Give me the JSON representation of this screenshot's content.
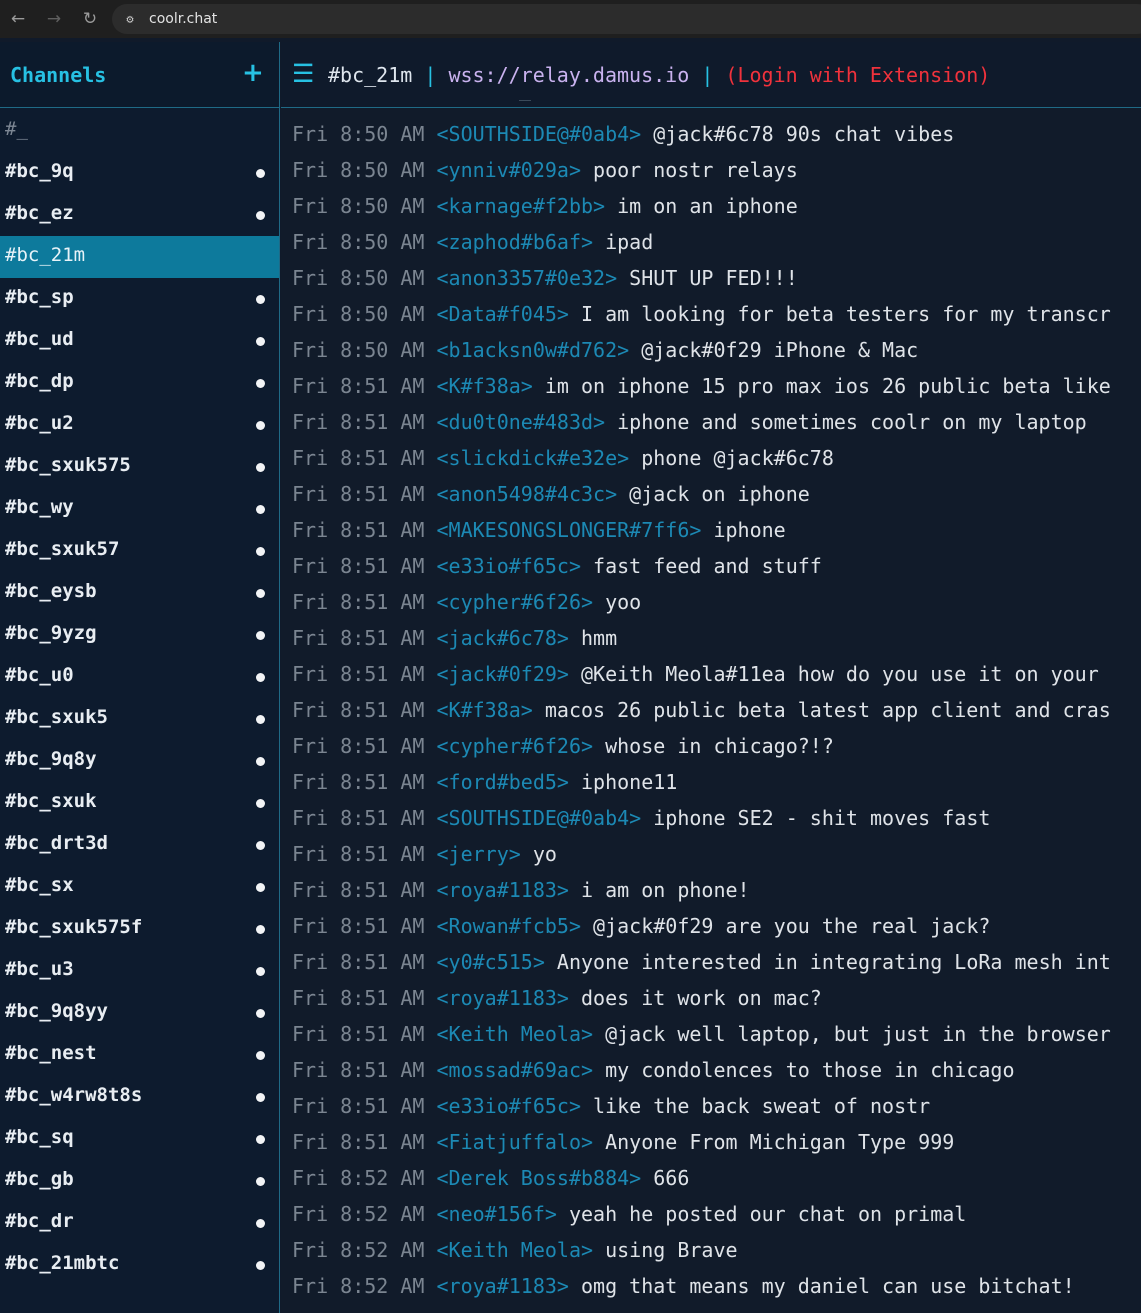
{
  "browser": {
    "url": "coolr.chat",
    "back_icon": "←",
    "forward_icon": "→",
    "reload_icon": "↻",
    "site_info_icon": "⚙"
  },
  "sidebar": {
    "title": "Channels",
    "add_icon": "+",
    "channels": [
      {
        "label": "#_",
        "dim": true,
        "active": false,
        "unread": false
      },
      {
        "label": "#bc_9q",
        "dim": false,
        "active": false,
        "unread": true
      },
      {
        "label": "#bc_ez",
        "dim": false,
        "active": false,
        "unread": true
      },
      {
        "label": "#bc_21m",
        "dim": false,
        "active": true,
        "unread": false
      },
      {
        "label": "#bc_sp",
        "dim": false,
        "active": false,
        "unread": true
      },
      {
        "label": "#bc_ud",
        "dim": false,
        "active": false,
        "unread": true
      },
      {
        "label": "#bc_dp",
        "dim": false,
        "active": false,
        "unread": true
      },
      {
        "label": "#bc_u2",
        "dim": false,
        "active": false,
        "unread": true
      },
      {
        "label": "#bc_sxuk575",
        "dim": false,
        "active": false,
        "unread": true
      },
      {
        "label": "#bc_wy",
        "dim": false,
        "active": false,
        "unread": true
      },
      {
        "label": "#bc_sxuk57",
        "dim": false,
        "active": false,
        "unread": true
      },
      {
        "label": "#bc_eysb",
        "dim": false,
        "active": false,
        "unread": true
      },
      {
        "label": "#bc_9yzg",
        "dim": false,
        "active": false,
        "unread": true
      },
      {
        "label": "#bc_u0",
        "dim": false,
        "active": false,
        "unread": true
      },
      {
        "label": "#bc_sxuk5",
        "dim": false,
        "active": false,
        "unread": true
      },
      {
        "label": "#bc_9q8y",
        "dim": false,
        "active": false,
        "unread": true
      },
      {
        "label": "#bc_sxuk",
        "dim": false,
        "active": false,
        "unread": true
      },
      {
        "label": "#bc_drt3d",
        "dim": false,
        "active": false,
        "unread": true
      },
      {
        "label": "#bc_sx",
        "dim": false,
        "active": false,
        "unread": true
      },
      {
        "label": "#bc_sxuk575f",
        "dim": false,
        "active": false,
        "unread": true
      },
      {
        "label": "#bc_u3",
        "dim": false,
        "active": false,
        "unread": true
      },
      {
        "label": "#bc_9q8yy",
        "dim": false,
        "active": false,
        "unread": true
      },
      {
        "label": "#bc_nest",
        "dim": false,
        "active": false,
        "unread": true
      },
      {
        "label": "#bc_w4rw8t8s",
        "dim": false,
        "active": false,
        "unread": true
      },
      {
        "label": "#bc_sq",
        "dim": false,
        "active": false,
        "unread": true
      },
      {
        "label": "#bc_gb",
        "dim": false,
        "active": false,
        "unread": true
      },
      {
        "label": "#bc_dr",
        "dim": false,
        "active": false,
        "unread": true
      },
      {
        "label": "#bc_21mbtc",
        "dim": false,
        "active": false,
        "unread": true
      }
    ]
  },
  "header": {
    "menu_icon": "☰",
    "channel": "#bc_21m",
    "separator": "|",
    "relay": "wss://relay.damus.io",
    "login": "(Login with Extension)"
  },
  "messages": [
    {
      "time": "Fri 8:50 AM",
      "nick": "<SOUTHSIDE@#0ab4>",
      "text": "@jack#6c78 90s chat vibes"
    },
    {
      "time": "Fri 8:50 AM",
      "nick": "<ynniv#029a>",
      "text": "poor nostr relays"
    },
    {
      "time": "Fri 8:50 AM",
      "nick": "<karnage#f2bb>",
      "text": "im on an iphone"
    },
    {
      "time": "Fri 8:50 AM",
      "nick": "<zaphod#b6af>",
      "text": "ipad"
    },
    {
      "time": "Fri 8:50 AM",
      "nick": "<anon3357#0e32>",
      "text": "SHUT UP FED!!!"
    },
    {
      "time": "Fri 8:50 AM",
      "nick": "<Data#f045>",
      "text": "I am looking for beta testers for my transcr"
    },
    {
      "time": "Fri 8:50 AM",
      "nick": "<b1acksn0w#d762>",
      "text": "@jack#0f29 iPhone & Mac"
    },
    {
      "time": "Fri 8:51 AM",
      "nick": "<K#f38a>",
      "text": "im on iphone 15 pro max ios 26 public beta like"
    },
    {
      "time": "Fri 8:51 AM",
      "nick": "<du0t0ne#483d>",
      "text": "iphone and sometimes coolr on my laptop"
    },
    {
      "time": "Fri 8:51 AM",
      "nick": "<slickdick#e32e>",
      "text": "phone @jack#6c78"
    },
    {
      "time": "Fri 8:51 AM",
      "nick": "<anon5498#4c3c>",
      "text": "@jack on iphone"
    },
    {
      "time": "Fri 8:51 AM",
      "nick": "<MAKESONGSLONGER#7ff6>",
      "text": "iphone"
    },
    {
      "time": "Fri 8:51 AM",
      "nick": "<e33io#f65c>",
      "text": "fast feed and stuff"
    },
    {
      "time": "Fri 8:51 AM",
      "nick": "<cypher#6f26>",
      "text": "yoo"
    },
    {
      "time": "Fri 8:51 AM",
      "nick": "<jack#6c78>",
      "text": "hmm"
    },
    {
      "time": "Fri 8:51 AM",
      "nick": "<jack#0f29>",
      "text": "@Keith Meola#11ea how do you use it on your"
    },
    {
      "time": "Fri 8:51 AM",
      "nick": "<K#f38a>",
      "text": "macos 26 public beta latest app client and cras"
    },
    {
      "time": "Fri 8:51 AM",
      "nick": "<cypher#6f26>",
      "text": "whose in chicago?!?"
    },
    {
      "time": "Fri 8:51 AM",
      "nick": "<ford#bed5>",
      "text": "iphone11"
    },
    {
      "time": "Fri 8:51 AM",
      "nick": "<SOUTHSIDE@#0ab4>",
      "text": "iphone SE2 - shit moves fast"
    },
    {
      "time": "Fri 8:51 AM",
      "nick": "<jerry>",
      "text": "yo"
    },
    {
      "time": "Fri 8:51 AM",
      "nick": "<roya#1183>",
      "text": "i am on phone!"
    },
    {
      "time": "Fri 8:51 AM",
      "nick": "<Rowan#fcb5>",
      "text": "@jack#0f29 are you the real jack?"
    },
    {
      "time": "Fri 8:51 AM",
      "nick": "<y0#c515>",
      "text": "Anyone interested in integrating LoRa mesh int"
    },
    {
      "time": "Fri 8:51 AM",
      "nick": "<roya#1183>",
      "text": "does it work on mac?"
    },
    {
      "time": "Fri 8:51 AM",
      "nick": "<Keith Meola>",
      "text": "@jack well laptop, but just in the browser"
    },
    {
      "time": "Fri 8:51 AM",
      "nick": "<mossad#69ac>",
      "text": "my condolences to those in chicago"
    },
    {
      "time": "Fri 8:51 AM",
      "nick": "<e33io#f65c>",
      "text": "like the back sweat of nostr"
    },
    {
      "time": "Fri 8:51 AM",
      "nick": "<Fiatjuffalo>",
      "text": "Anyone From Michigan Type 999"
    },
    {
      "time": "Fri 8:52 AM",
      "nick": "<Derek Boss#b884>",
      "text": "666"
    },
    {
      "time": "Fri 8:52 AM",
      "nick": "<neo#156f>",
      "text": "yeah he posted our chat on primal"
    },
    {
      "time": "Fri 8:52 AM",
      "nick": "<Keith Meola>",
      "text": "using Brave"
    },
    {
      "time": "Fri 8:52 AM",
      "nick": "<roya#1183>",
      "text": "omg that means my daniel can use bitchat!"
    }
  ]
}
